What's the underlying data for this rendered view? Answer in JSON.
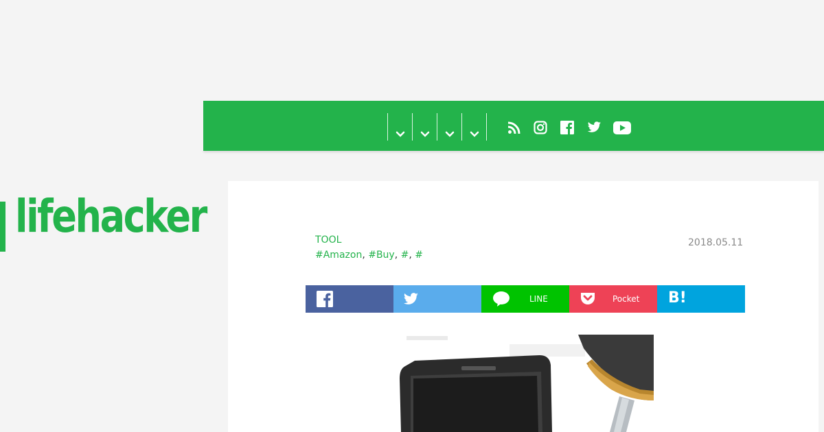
{
  "brand": {
    "logo_text": "lifehacker",
    "accent_color": "#23b34b"
  },
  "nav": {
    "dropdowns": [
      {
        "icon": "chevron-down-icon"
      },
      {
        "icon": "chevron-down-icon"
      },
      {
        "icon": "chevron-down-icon"
      },
      {
        "icon": "chevron-down-icon"
      }
    ],
    "social": [
      "rss-icon",
      "instagram-icon",
      "facebook-icon",
      "twitter-icon",
      "youtube-icon"
    ]
  },
  "article": {
    "category": "TOOL",
    "tags": [
      "#Amazon",
      "#Buy",
      "#",
      "#"
    ],
    "date": "2018.05.11"
  },
  "share": {
    "buttons": [
      {
        "icon": "facebook-icon",
        "label": "",
        "color": "#4a629f"
      },
      {
        "icon": "twitter-icon",
        "label": "",
        "color": "#5aacec"
      },
      {
        "icon": "line-icon",
        "label": "LINE",
        "color": "#00c300"
      },
      {
        "icon": "pocket-icon",
        "label": "Pocket",
        "color": "#ee4256"
      },
      {
        "icon": "hatena-bookmark-icon",
        "label": "B!",
        "color": "#00a4de"
      }
    ]
  }
}
